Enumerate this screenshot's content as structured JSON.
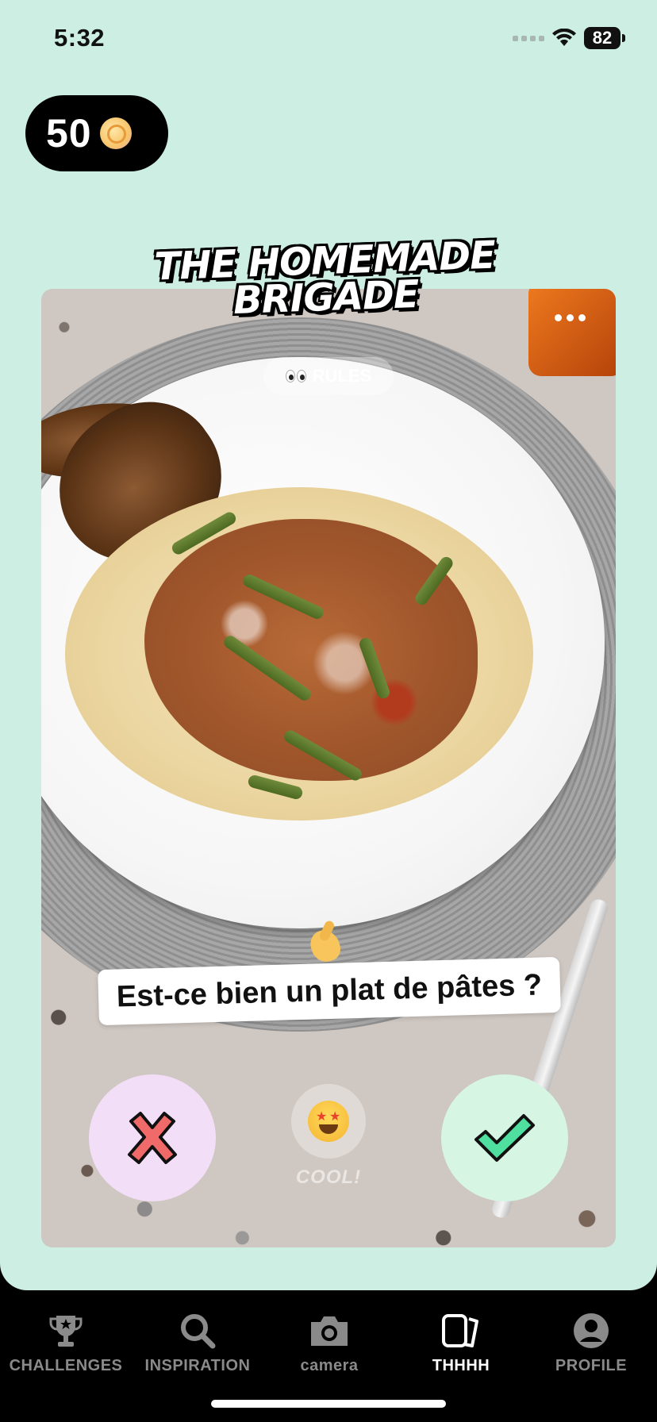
{
  "status_bar": {
    "time": "5:32",
    "battery": "82"
  },
  "coins": {
    "count": "50",
    "icon": "coin-icon"
  },
  "challenge": {
    "title_line1": "THE HOMEMADE",
    "title_line2": "BRIGADE",
    "rules_label": "RULES",
    "question": "Est-ce bien un plat de pâtes ?",
    "reject_icon": "x-icon",
    "approve_icon": "check-icon",
    "cool_label": "COOL!"
  },
  "tabs": [
    {
      "label": "CHALLENGES",
      "icon": "trophy-icon",
      "active": false
    },
    {
      "label": "INSPIRATION",
      "icon": "search-icon",
      "active": false
    },
    {
      "label": "camera",
      "icon": "camera-icon",
      "active": false
    },
    {
      "label": "THHHH",
      "icon": "cards-icon",
      "active": true
    },
    {
      "label": "PROFILE",
      "icon": "profile-icon",
      "active": false
    }
  ],
  "colors": {
    "background": "#cdeee3",
    "reject_bg": "#f3def8",
    "approve_bg": "#d6f6e3",
    "reject_x": "#f06a6a",
    "approve_check": "#4fe0a0"
  }
}
